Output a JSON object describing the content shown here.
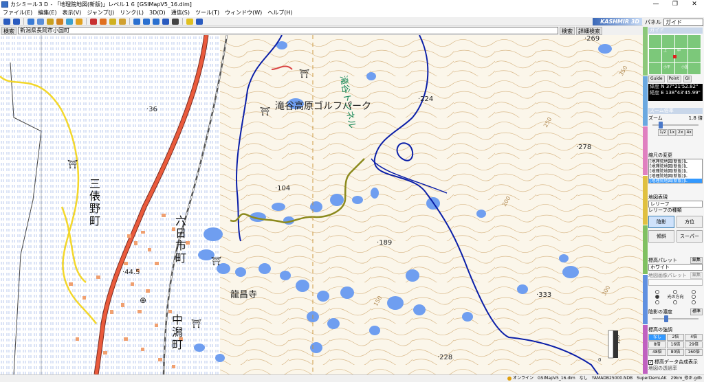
{
  "window": {
    "title": "カシミール３Ｄ - 「地理院地図(新版)」レベル１６ [GSIMapV5_16.dim]",
    "buttons": [
      "—",
      "❐",
      "✕"
    ]
  },
  "menu": [
    "ファイル(E)",
    "編集(E)",
    "表示(V)",
    "ジャンプ(J)",
    "リンク(L)",
    "3D(D)",
    "通信(S)",
    "ツール(T)",
    "ウィンドウ(W)",
    "ヘルプ(H)"
  ],
  "toolbar": {
    "brand": "KASHMIR 3D",
    "icons": [
      {
        "name": "zoom-in-icon",
        "color": "#2a5bbf"
      },
      {
        "name": "zoom-out-icon",
        "color": "#2a5bbf"
      },
      {
        "name": "sep"
      },
      {
        "name": "pointer-icon",
        "color": "#3a7bd5"
      },
      {
        "name": "car-icon",
        "color": "#5a8ed8"
      },
      {
        "name": "car-icon",
        "color": "#c8a020"
      },
      {
        "name": "car-icon",
        "color": "#d08020"
      },
      {
        "name": "car-icon",
        "color": "#3aa0d0"
      },
      {
        "name": "car-icon",
        "color": "#e0a020"
      },
      {
        "name": "sep"
      },
      {
        "name": "waypoint-icon",
        "color": "#c83030"
      },
      {
        "name": "track-icon",
        "color": "#e07020"
      },
      {
        "name": "route-icon",
        "color": "#d0b020"
      },
      {
        "name": "pencil-icon",
        "color": "#d0a030"
      },
      {
        "name": "sep"
      },
      {
        "name": "arrow-icon",
        "color": "#2a70d0"
      },
      {
        "name": "arrows-icon",
        "color": "#2a70d0"
      },
      {
        "name": "card-icon",
        "color": "#2a70d0"
      },
      {
        "name": "save-icon",
        "color": "#2a5bbf"
      },
      {
        "name": "device-icon",
        "color": "#444444"
      },
      {
        "name": "sep"
      },
      {
        "name": "lamp-icon",
        "color": "#e0c020"
      },
      {
        "name": "help-icon",
        "color": "#2a5bbf"
      }
    ]
  },
  "search": {
    "label": "検索",
    "value": "新潟県長岡市小国町",
    "search_button": "検索",
    "detail_button": "詳細検索"
  },
  "map": {
    "places": [
      "滝谷高原ゴルフパーク",
      "龍昌寺",
      "滝谷トンネル"
    ],
    "vertical_places": [
      [
        "三",
        "俵",
        "野",
        "町"
      ],
      [
        "六",
        "日",
        "市",
        "町"
      ],
      [
        "中",
        "潟",
        "町"
      ]
    ],
    "elevations": [
      "269",
      "224",
      "278",
      "104",
      "189",
      "333",
      "228",
      "36",
      "44.5"
    ],
    "contour_labels": [
      "250",
      "300",
      "150",
      "200",
      "350"
    ],
    "scale_labels": [
      "0",
      "150"
    ]
  },
  "panel": {
    "label": "パネル",
    "select_value": "ガイド",
    "guide": {
      "header": "ガイド",
      "minimap_labels": [
        "上",
        "中",
        "小平",
        "小国"
      ],
      "tabs": [
        "Guide",
        "Point",
        "GI"
      ]
    },
    "coords": {
      "lat_key": "緯度",
      "lat": "N 37°21'52.82\"",
      "lon_key": "経度",
      "lon": "E 138°43'45.99\""
    },
    "zoom": {
      "header": "ズーム倍率",
      "label": "ズーム",
      "value": "1.8 倍",
      "level": 0.18,
      "scales": [
        "1/2",
        "1x",
        "2x",
        "4x"
      ]
    },
    "scale_change": {
      "header": "縮尺の変更",
      "items": [
        "[地理院地図(新版)]L",
        "[地理院地図(新版)]L",
        "[地理院地図(新版)]L",
        "[地理院地図(新版)]L",
        "[地理院地図(新版)]L"
      ],
      "selected_index": 4
    },
    "relief": {
      "header": "地図表現",
      "select": "レリーフ",
      "type_label": "レリーフの種類",
      "buttons": [
        "陰影",
        "方位",
        "傾斜",
        "スーパー"
      ]
    },
    "palette": {
      "label": "標高パレット",
      "edit": "編集",
      "value": "ホワイト"
    },
    "shade_palette": {
      "label": "地図画像パレット",
      "edit": "編集",
      "value": ""
    },
    "light": {
      "label": "光の方向"
    },
    "shade_strength": {
      "label": "陰影の濃度",
      "button": "標準",
      "level": 0.3
    },
    "emphasis": {
      "label": "標高の強調",
      "options": [
        "なし",
        "2倍",
        "4倍",
        "8倍",
        "16倍",
        "29倍",
        "48倍",
        "80倍",
        "160倍"
      ],
      "selected_index": 0
    },
    "checkbox": {
      "label": "標高データ合成表示",
      "checked": true
    },
    "truncated": "地図の透過率"
  },
  "status": {
    "online": "オンライン",
    "cells": [
      "GSIMapV5_16.dim",
      "なし",
      "YAMADB25000.NDB",
      "SuperDemLAK",
      "29km_修正.gdb"
    ]
  }
}
